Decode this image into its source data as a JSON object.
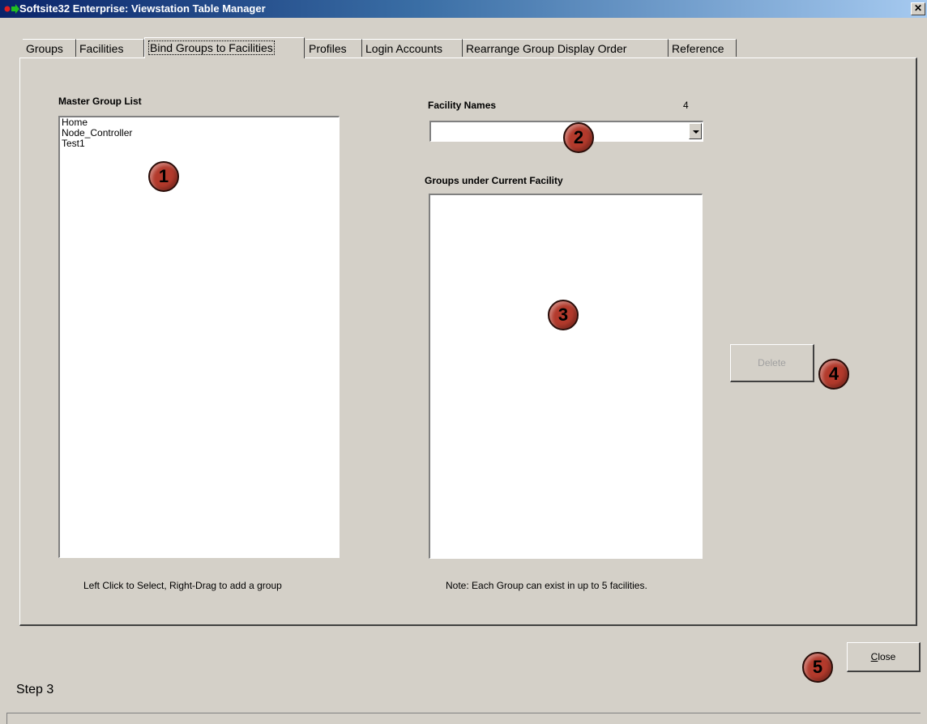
{
  "window": {
    "title": "Softsite32 Enterprise: Viewstation Table Manager",
    "close_glyph": "✕"
  },
  "tabs": [
    {
      "label": "Groups"
    },
    {
      "label": "Facilities"
    },
    {
      "label": "Bind Groups to Facilities"
    },
    {
      "label": "Profiles"
    },
    {
      "label": "Login Accounts"
    },
    {
      "label": "Rearrange Group Display Order"
    },
    {
      "label": "Reference"
    }
  ],
  "active_tab": "Bind Groups to Facilities",
  "master": {
    "title": "Master Group List",
    "items": [
      "Home",
      "Node_Controller",
      "Test1"
    ],
    "hint": "Left Click to Select, Right-Drag to add a group"
  },
  "facility": {
    "title": "Facility Names",
    "count": "4",
    "selected": ""
  },
  "groups_current": {
    "title": "Groups under Current Facility",
    "items": [],
    "note": "Note: Each Group can exist in up to 5 facilities."
  },
  "buttons": {
    "delete": "Delete",
    "close": "Close"
  },
  "badges": [
    "1",
    "2",
    "3",
    "4",
    "5"
  ],
  "footer": {
    "step": "Step 3"
  },
  "colors": {
    "face": "#d4d0c8",
    "title_start": "#0a246a",
    "title_end": "#a6caf0",
    "badge": "#b33a2c"
  }
}
